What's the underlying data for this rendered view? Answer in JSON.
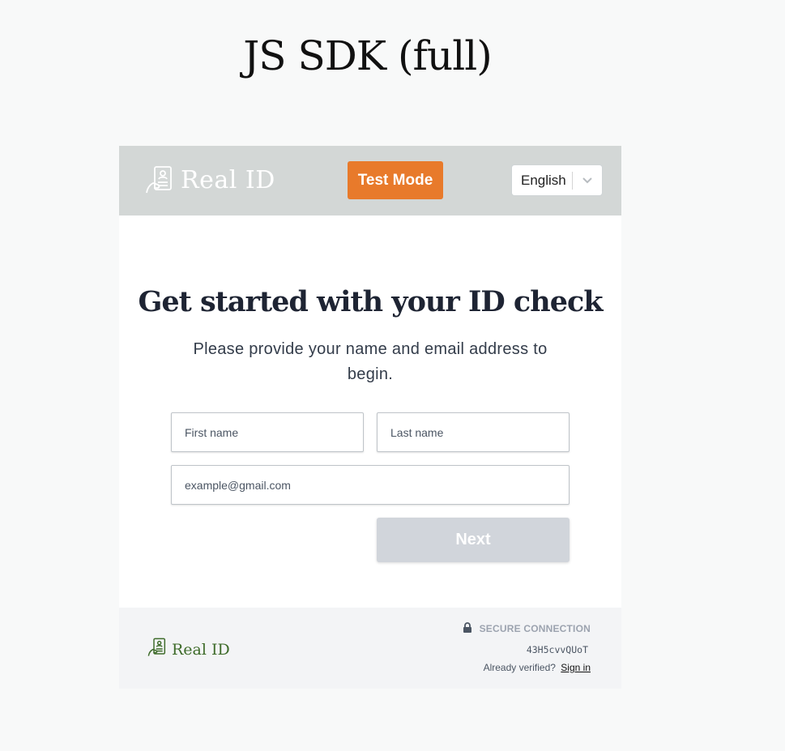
{
  "page": {
    "title": "JS SDK (full)"
  },
  "header": {
    "brand": "Real ID",
    "test_mode": "Test Mode",
    "language": {
      "selected": "English"
    }
  },
  "main": {
    "heading": "Get started with your ID check",
    "subheading": "Please provide your name and email address to begin.",
    "first_name_placeholder": "First name",
    "last_name_placeholder": "Last name",
    "email_placeholder": "example@gmail.com",
    "next_label": "Next"
  },
  "footer": {
    "brand": "Real ID",
    "secure_label": "SECURE CONNECTION",
    "session_code": "43H5cvvQUoT",
    "already_verified": "Already verified?",
    "sign_in": "Sign in"
  },
  "colors": {
    "header_bg": "#d3d7d6",
    "test_mode_bg": "#e87a2b",
    "next_disabled_bg": "#d1d5db",
    "footer_brand": "#3e6b2a"
  },
  "icons": [
    "id-card-hand-icon",
    "chevron-down-icon",
    "lock-icon"
  ]
}
